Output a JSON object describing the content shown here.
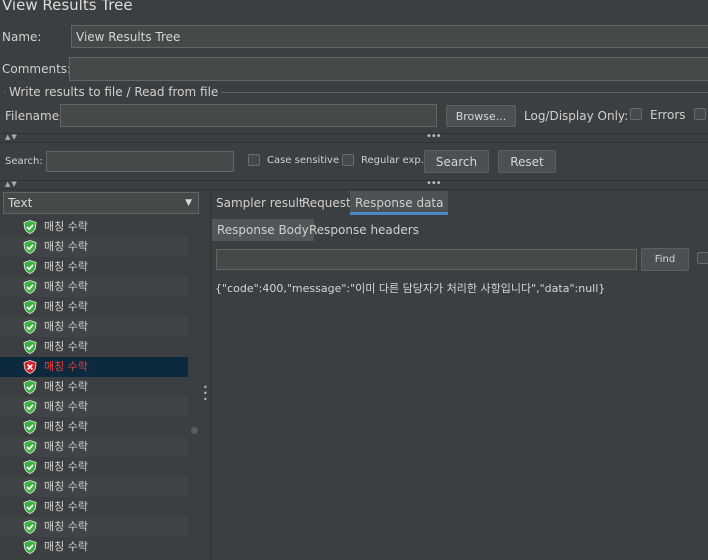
{
  "window": {
    "title": "View Results Tree"
  },
  "name_row": {
    "label": "Name:",
    "value": "View Results Tree"
  },
  "comments_row": {
    "label": "Comments:",
    "value": ""
  },
  "file_group": {
    "title": "Write results to file / Read from file",
    "filename_label": "Filename",
    "filename_value": "",
    "browse_label": "Browse...",
    "log_display_label": "Log/Display Only:",
    "errors_label": "Errors"
  },
  "search_bar": {
    "label": "Search:",
    "value": "",
    "case_sensitive_label": "Case sensitive",
    "regex_label": "Regular exp.",
    "search_button": "Search",
    "reset_button": "Reset"
  },
  "renderer": {
    "selected": "Text"
  },
  "tree": {
    "items": [
      {
        "label": "매칭 수락",
        "status": "success"
      },
      {
        "label": "매칭 수락",
        "status": "success"
      },
      {
        "label": "매칭 수락",
        "status": "success"
      },
      {
        "label": "매칭 수락",
        "status": "success"
      },
      {
        "label": "매칭 수락",
        "status": "success"
      },
      {
        "label": "매칭 수락",
        "status": "success"
      },
      {
        "label": "매칭 수락",
        "status": "success"
      },
      {
        "label": "매칭 수락",
        "status": "error"
      },
      {
        "label": "매칭 수락",
        "status": "success"
      },
      {
        "label": "매칭 수락",
        "status": "success"
      },
      {
        "label": "매칭 수락",
        "status": "success"
      },
      {
        "label": "매칭 수락",
        "status": "success"
      },
      {
        "label": "매칭 수락",
        "status": "success"
      },
      {
        "label": "매칭 수락",
        "status": "success"
      },
      {
        "label": "매칭 수락",
        "status": "success"
      },
      {
        "label": "매칭 수락",
        "status": "success"
      },
      {
        "label": "매칭 수락",
        "status": "success"
      }
    ]
  },
  "result_tabs": [
    "Sampler result",
    "Request",
    "Response data"
  ],
  "response_tabs": [
    "Response Body",
    "Response headers"
  ],
  "find": {
    "value": "",
    "button": "Find"
  },
  "response_body": "{\"code\":400,\"message\":\"이미 다른 담당자가 처리한 사항입니다\",\"data\":null}",
  "colors": {
    "background": "#3c3f41",
    "selection": "#0d293e",
    "accent": "#4a88c7",
    "error_text": "#e84040",
    "success_icon": "#3cb043",
    "error_icon": "#d0202a"
  }
}
